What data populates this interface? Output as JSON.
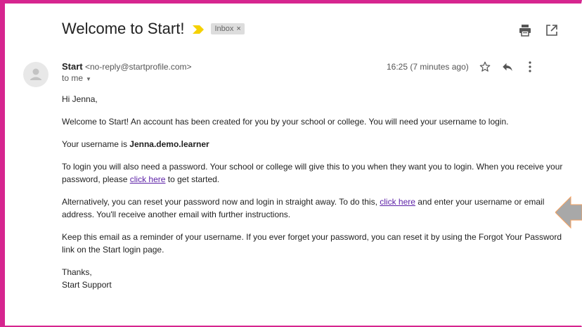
{
  "email": {
    "subject": "Welcome to Start!",
    "label": "Inbox",
    "label_close": "×",
    "sender_name": "Start",
    "sender_email": "<no-reply@startprofile.com>",
    "recipient": "to me",
    "timestamp": "16:25 (7 minutes ago)"
  },
  "body": {
    "greeting": "Hi Jenna,",
    "p1": "Welcome to Start! An account has been created for you by your school or college. You will need your username to login.",
    "p2_prefix": "Your username is ",
    "username": "Jenna.demo.learner",
    "p3_text": "To login you will also need a password. Your school or college will give this to you when they want you to login. When you receive your password, please ",
    "p3_link": "click here",
    "p3_suffix": " to get started.",
    "p4_text": "Alternatively, you can reset your password now and login in straight away. To do this, ",
    "p4_link": "click here",
    "p4_suffix": " and enter your username or email address. You'll receive another email with further instructions.",
    "p5": "Keep this email as a reminder of your username. If you ever forget your password, you can reset it by using the Forgot Your Password link on the Start login page.",
    "signoff": "Thanks,",
    "signature": "Start Support"
  },
  "icons": {
    "important_marker": "important-marker-icon",
    "print": "print-icon",
    "open_new_window": "open-in-new-window-icon",
    "avatar": "avatar-icon",
    "star": "star-icon",
    "reply": "reply-icon",
    "more": "more-vert-icon",
    "callout_arrow": "arrow-left-icon"
  },
  "colors": {
    "frame": "#d6258f",
    "important": "#f5d100",
    "label_bg": "#dddddd",
    "link": "#5b1fa6",
    "arrow": "#a8a8a8"
  }
}
